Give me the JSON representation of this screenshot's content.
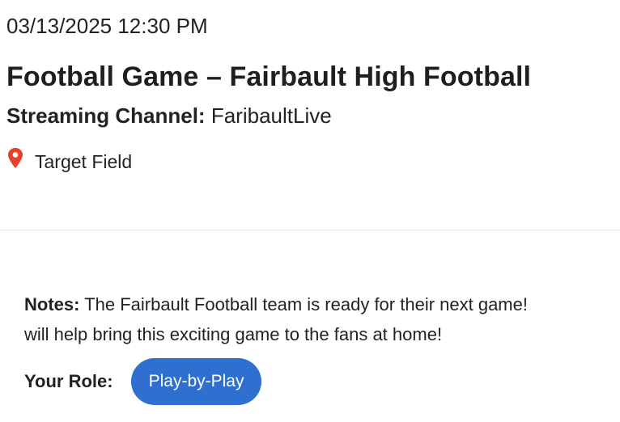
{
  "event": {
    "datetime": "03/13/2025 12:30 PM",
    "title": "Football Game – Fairbault High Football",
    "channel_label": "Streaming Channel:",
    "channel_value": "FaribaultLive",
    "location": "Target Field"
  },
  "notes": {
    "label": "Notes:",
    "line1": "The Fairbault Football team is ready for their next game!",
    "line2": "will help bring this exciting game to the fans at home!"
  },
  "role": {
    "label": "Your Role:",
    "button_label": "Play-by-Play"
  },
  "icons": {
    "location": "map-pin-icon"
  },
  "colors": {
    "pin": "#e8402b",
    "role_button": "#2e6fd0",
    "divider": "#e3e3e3"
  }
}
